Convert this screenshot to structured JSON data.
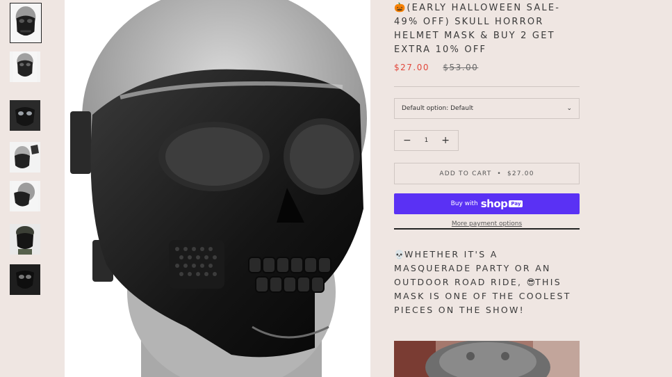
{
  "product": {
    "title": "🎃(EARLY HALLOWEEN SALE- 49% OFF) SKULL HORROR HELMET MASK & BUY 2 GET EXTRA 10% OFF",
    "price": "$27.00",
    "compare_price": "$53.00"
  },
  "variant_select": {
    "selected": "Default option: Default",
    "icon": "chevron-down-icon"
  },
  "quantity": {
    "value": "1",
    "minus_label": "−",
    "plus_label": "+"
  },
  "add_to_cart": {
    "label": "ADD TO CART",
    "separator": "•",
    "price": "$27.00"
  },
  "shop_pay": {
    "prefix": "Buy with",
    "brand": "shop",
    "badge": "Pay"
  },
  "more_payment_options": "More payment options",
  "description": {
    "emoji_skull": "💀",
    "text_part1": "WHETHER IT'S A MASQUERADE PARTY OR AN OUTDOOR ROAD RIDE, ",
    "emoji_cool": "😎",
    "text_part2": "THIS MASK IS ONE OF THE COOLEST PIECES ON THE SHOW!"
  },
  "thumbnails": [
    {
      "name": "thumb-1",
      "active": true
    },
    {
      "name": "thumb-2"
    },
    {
      "name": "thumb-3"
    },
    {
      "name": "thumb-4"
    },
    {
      "name": "thumb-5"
    },
    {
      "name": "thumb-6"
    },
    {
      "name": "thumb-7"
    }
  ],
  "colors": {
    "price": "#e2473b",
    "shop_pay": "#5a31f4",
    "background": "#efe6e2"
  }
}
